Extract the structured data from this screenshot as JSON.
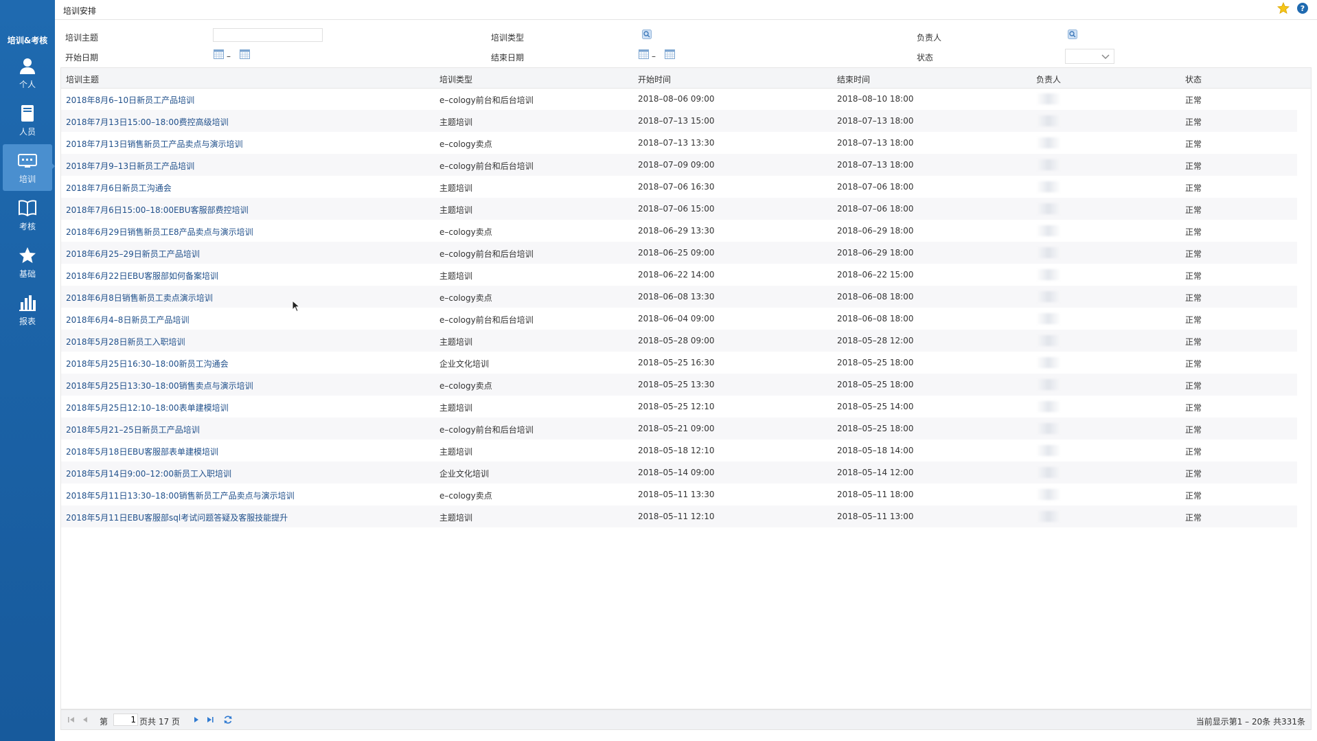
{
  "app": {
    "title": "培训&考核"
  },
  "sidebar": {
    "items": [
      {
        "label": "个人",
        "icon": "person-icon"
      },
      {
        "label": "人员",
        "icon": "book-icon"
      },
      {
        "label": "培训",
        "icon": "training-icon",
        "active": true
      },
      {
        "label": "考核",
        "icon": "open-book-icon"
      },
      {
        "label": "基础",
        "icon": "star-icon"
      },
      {
        "label": "报表",
        "icon": "bar-chart-icon"
      }
    ]
  },
  "page": {
    "title": "培训安排"
  },
  "filters": {
    "subject_label": "培训主题",
    "subject_value": "",
    "type_label": "培训类型",
    "owner_label": "负责人",
    "start_date_label": "开始日期",
    "end_date_label": "结束日期",
    "status_label": "状态",
    "status_value": "",
    "date_separator": "–"
  },
  "table": {
    "headers": [
      "培训主题",
      "培训类型",
      "开始时间",
      "结束时间",
      "负责人",
      "状态"
    ],
    "rows": [
      {
        "subject": "2018年8月6–10日新员工产品培训",
        "type": "e–cology前台和后台培训",
        "start": "2018–08–06 09:00",
        "end": "2018–08–10 18:00",
        "status": "正常"
      },
      {
        "subject": "2018年7月13日15:00–18:00费控高级培训",
        "type": "主题培训",
        "start": "2018–07–13 15:00",
        "end": "2018–07–13 18:00",
        "status": "正常"
      },
      {
        "subject": "2018年7月13日销售新员工产品卖点与演示培训",
        "type": "e–cology卖点",
        "start": "2018–07–13 13:30",
        "end": "2018–07–13 18:00",
        "status": "正常"
      },
      {
        "subject": "2018年7月9–13日新员工产品培训",
        "type": "e–cology前台和后台培训",
        "start": "2018–07–09 09:00",
        "end": "2018–07–13 18:00",
        "status": "正常"
      },
      {
        "subject": "2018年7月6日新员工沟通会",
        "type": "主题培训",
        "start": "2018–07–06 16:30",
        "end": "2018–07–06 18:00",
        "status": "正常"
      },
      {
        "subject": "2018年7月6日15:00–18:00EBU客服部费控培训",
        "type": "主题培训",
        "start": "2018–07–06 15:00",
        "end": "2018–07–06 18:00",
        "status": "正常"
      },
      {
        "subject": "2018年6月29日销售新员工E8产品卖点与演示培训",
        "type": "e–cology卖点",
        "start": "2018–06–29 13:30",
        "end": "2018–06–29 18:00",
        "status": "正常"
      },
      {
        "subject": "2018年6月25–29日新员工产品培训",
        "type": "e–cology前台和后台培训",
        "start": "2018–06–25 09:00",
        "end": "2018–06–29 18:00",
        "status": "正常"
      },
      {
        "subject": "2018年6月22日EBU客服部如何备案培训",
        "type": "主题培训",
        "start": "2018–06–22 14:00",
        "end": "2018–06–22 15:00",
        "status": "正常"
      },
      {
        "subject": "2018年6月8日销售新员工卖点演示培训",
        "type": "e–cology卖点",
        "start": "2018–06–08 13:30",
        "end": "2018–06–08 18:00",
        "status": "正常"
      },
      {
        "subject": "2018年6月4–8日新员工产品培训",
        "type": "e–cology前台和后台培训",
        "start": "2018–06–04 09:00",
        "end": "2018–06–08 18:00",
        "status": "正常"
      },
      {
        "subject": "2018年5月28日新员工入职培训",
        "type": "主题培训",
        "start": "2018–05–28 09:00",
        "end": "2018–05–28 12:00",
        "status": "正常"
      },
      {
        "subject": "2018年5月25日16:30–18:00新员工沟通会",
        "type": "企业文化培训",
        "start": "2018–05–25 16:30",
        "end": "2018–05–25 18:00",
        "status": "正常"
      },
      {
        "subject": "2018年5月25日13:30–18:00销售卖点与演示培训",
        "type": "e–cology卖点",
        "start": "2018–05–25 13:30",
        "end": "2018–05–25 18:00",
        "status": "正常"
      },
      {
        "subject": "2018年5月25日12:10–18:00表单建模培训",
        "type": "主题培训",
        "start": "2018–05–25 12:10",
        "end": "2018–05–25 14:00",
        "status": "正常"
      },
      {
        "subject": "2018年5月21–25日新员工产品培训",
        "type": "e–cology前台和后台培训",
        "start": "2018–05–21 09:00",
        "end": "2018–05–25 18:00",
        "status": "正常"
      },
      {
        "subject": "2018年5月18日EBU客服部表单建模培训",
        "type": "主题培训",
        "start": "2018–05–18 12:10",
        "end": "2018–05–18 14:00",
        "status": "正常"
      },
      {
        "subject": "2018年5月14日9:00–12:00新员工入职培训",
        "type": "企业文化培训",
        "start": "2018–05–14 09:00",
        "end": "2018–05–14 12:00",
        "status": "正常"
      },
      {
        "subject": "2018年5月11日13:30–18:00销售新员工产品卖点与演示培训",
        "type": "e–cology卖点",
        "start": "2018–05–11 13:30",
        "end": "2018–05–11 18:00",
        "status": "正常"
      },
      {
        "subject": "2018年5月11日EBU客服部sql考试问题答疑及客服技能提升",
        "type": "主题培训",
        "start": "2018–05–11 12:10",
        "end": "2018–05–11 13:00",
        "status": "正常"
      }
    ]
  },
  "pager": {
    "page_prefix": "第",
    "current_page": "1",
    "page_suffix": "页共 17 页",
    "summary": "当前显示第1 – 20条 共331条"
  },
  "colors": {
    "sidebar": "#1f6ab0",
    "active": "#4a8fcf",
    "link": "#1f4f8a"
  }
}
